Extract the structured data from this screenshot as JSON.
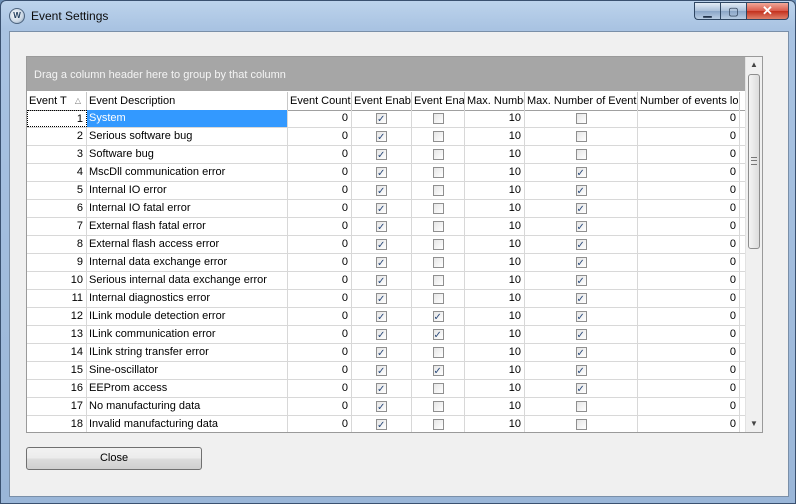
{
  "window": {
    "title": "Event Settings",
    "icon_text": "W",
    "minimize": "▁",
    "maximize": "▢",
    "close": "✕"
  },
  "grid": {
    "group_panel_text": "Drag a column header here to group by that column",
    "columns": [
      "Event T",
      "Event Description",
      "Event Count",
      "Event Enab",
      "Event Ena",
      "Max. Numbe",
      "Max. Number of Event",
      "Number of events lo"
    ],
    "sort_indicator": "△",
    "rows": [
      {
        "id": "1",
        "desc": "System",
        "count": "0",
        "enab": true,
        "ena": false,
        "max": "10",
        "maxev": false,
        "logged": "0"
      },
      {
        "id": "2",
        "desc": "Serious software bug",
        "count": "0",
        "enab": true,
        "ena": false,
        "max": "10",
        "maxev": false,
        "logged": "0"
      },
      {
        "id": "3",
        "desc": "Software bug",
        "count": "0",
        "enab": true,
        "ena": false,
        "max": "10",
        "maxev": false,
        "logged": "0"
      },
      {
        "id": "4",
        "desc": "MscDll communication error",
        "count": "0",
        "enab": true,
        "ena": false,
        "max": "10",
        "maxev": true,
        "logged": "0"
      },
      {
        "id": "5",
        "desc": "Internal IO error",
        "count": "0",
        "enab": true,
        "ena": false,
        "max": "10",
        "maxev": true,
        "logged": "0"
      },
      {
        "id": "6",
        "desc": "Internal IO fatal error",
        "count": "0",
        "enab": true,
        "ena": false,
        "max": "10",
        "maxev": true,
        "logged": "0"
      },
      {
        "id": "7",
        "desc": "External flash fatal error",
        "count": "0",
        "enab": true,
        "ena": false,
        "max": "10",
        "maxev": true,
        "logged": "0"
      },
      {
        "id": "8",
        "desc": "External flash access error",
        "count": "0",
        "enab": true,
        "ena": false,
        "max": "10",
        "maxev": true,
        "logged": "0"
      },
      {
        "id": "9",
        "desc": "Internal data exchange error",
        "count": "0",
        "enab": true,
        "ena": false,
        "max": "10",
        "maxev": true,
        "logged": "0"
      },
      {
        "id": "10",
        "desc": "Serious internal data exchange error",
        "count": "0",
        "enab": true,
        "ena": false,
        "max": "10",
        "maxev": true,
        "logged": "0"
      },
      {
        "id": "11",
        "desc": "Internal diagnostics error",
        "count": "0",
        "enab": true,
        "ena": false,
        "max": "10",
        "maxev": true,
        "logged": "0"
      },
      {
        "id": "12",
        "desc": "ILink module detection error",
        "count": "0",
        "enab": true,
        "ena": true,
        "max": "10",
        "maxev": true,
        "logged": "0"
      },
      {
        "id": "13",
        "desc": "ILink communication error",
        "count": "0",
        "enab": true,
        "ena": true,
        "max": "10",
        "maxev": true,
        "logged": "0"
      },
      {
        "id": "14",
        "desc": "ILink string transfer error",
        "count": "0",
        "enab": true,
        "ena": false,
        "max": "10",
        "maxev": true,
        "logged": "0"
      },
      {
        "id": "15",
        "desc": "Sine-oscillator",
        "count": "0",
        "enab": true,
        "ena": true,
        "max": "10",
        "maxev": true,
        "logged": "0"
      },
      {
        "id": "16",
        "desc": "EEProm access",
        "count": "0",
        "enab": true,
        "ena": false,
        "max": "10",
        "maxev": true,
        "logged": "0"
      },
      {
        "id": "17",
        "desc": "No manufacturing data",
        "count": "0",
        "enab": true,
        "ena": false,
        "max": "10",
        "maxev": false,
        "logged": "0"
      },
      {
        "id": "18",
        "desc": "Invalid manufacturing data",
        "count": "0",
        "enab": true,
        "ena": false,
        "max": "10",
        "maxev": false,
        "logged": "0"
      }
    ],
    "selected_row_index": 0,
    "scrollbar": {
      "up": "▲",
      "down": "▼"
    }
  },
  "buttons": {
    "close_label": "Close"
  }
}
